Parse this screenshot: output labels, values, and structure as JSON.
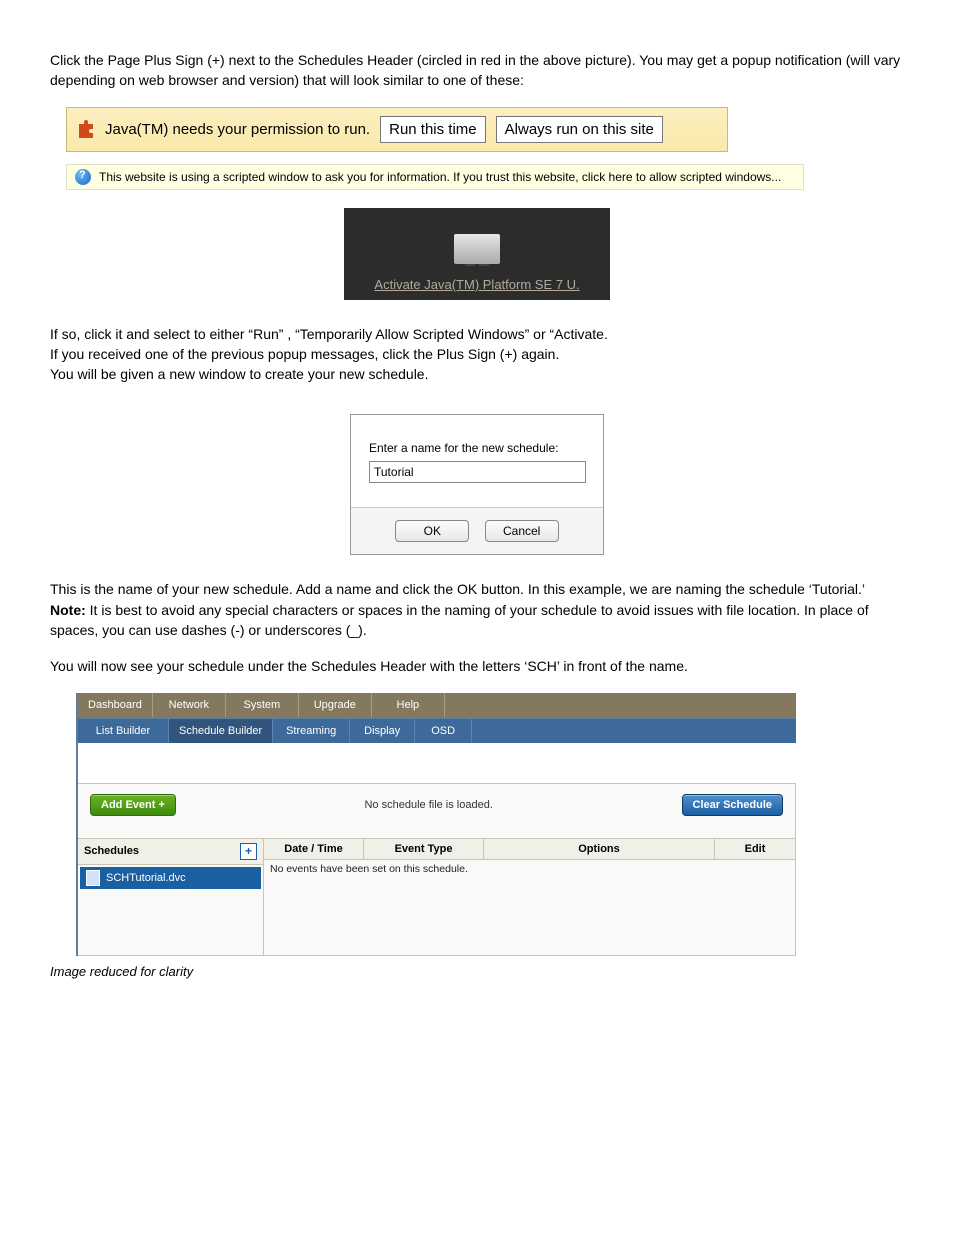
{
  "paras": {
    "p1": "Click the Page Plus Sign (+) next to the Schedules Header (circled in red in the above picture).  You may get a popup notification (will vary depending on web browser and version) that will look similar to one of these:",
    "p2a": "If so, click it and select to either “Run” , “Temporarily Allow Scripted Windows” or “Activate.",
    "p2b": "If you received one of the previous popup messages, click the Plus Sign (+) again.",
    "p2c": "You will be given a new window to create your new schedule.",
    "p3a": "This is the name of your new schedule.  Add a name and click the OK button.  In this example, we are naming the schedule ‘Tutorial.’  ",
    "p3note": "Note:",
    "p3b": " It is best to avoid any special characters or spaces in the naming of your schedule to avoid issues with file location.  In place of spaces, you can use dashes (-) or underscores (_).",
    "p4": "You will now see your schedule under the Schedules Header with the letters ‘SCH’ in front of the name.",
    "caption": "Image reduced for clarity"
  },
  "java_bar": {
    "text": "Java(TM) needs your permission to run.",
    "btn1": "Run this time",
    "btn2": "Always run on this site"
  },
  "ie_bar": {
    "text": "This website is using a scripted window to ask you for information. If you trust this website, click here to allow scripted windows..."
  },
  "activate": {
    "link": "Activate Java(TM) Platform SE 7 U."
  },
  "dialog": {
    "label": "Enter a name for the new schedule:",
    "value": "Tutorial",
    "ok": "OK",
    "cancel": "Cancel"
  },
  "app": {
    "tabs1": [
      "Dashboard",
      "Network",
      "System",
      "Upgrade",
      "Help"
    ],
    "tabs2": [
      "List Builder",
      "Schedule Builder",
      "Streaming",
      "Display",
      "OSD"
    ],
    "tabs2_selected": 1,
    "add_event": "Add Event +",
    "status": "No schedule file is loaded.",
    "clear": "Clear Schedule",
    "left_header": "Schedules",
    "plus": "+",
    "item": "SCHTutorial.dvc",
    "cols": [
      "Date / Time",
      "Event Type",
      "Options",
      "Edit"
    ],
    "no_events": "No events have been set on this schedule."
  }
}
